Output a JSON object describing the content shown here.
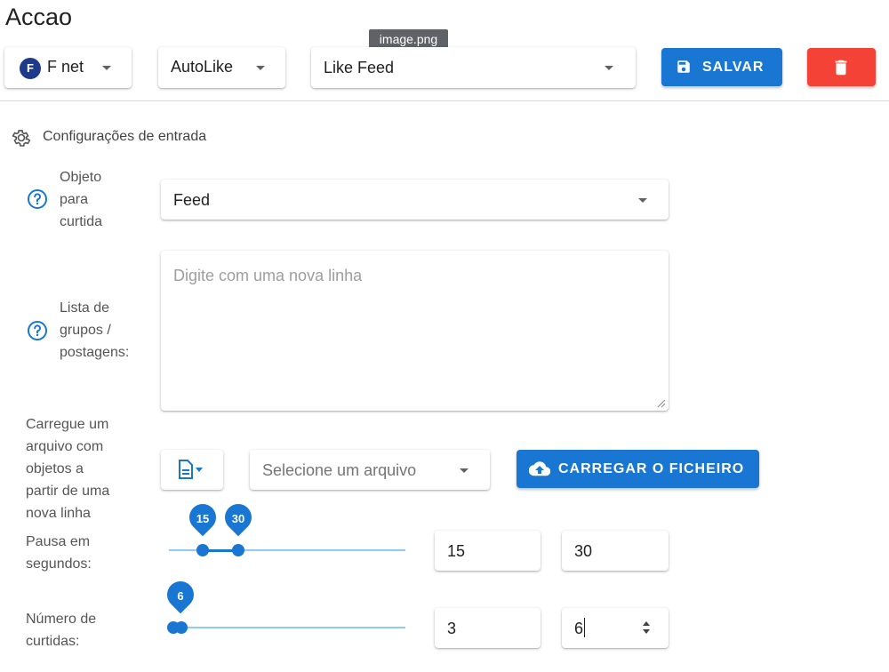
{
  "page": {
    "title": "Accao",
    "tooltip": "image.png"
  },
  "toolbar": {
    "account": {
      "initial": "F",
      "name": "F net"
    },
    "type": "AutoLike",
    "action": "Like Feed",
    "save_label": "SALVAR",
    "colors": {
      "primary": "#1976d2",
      "danger": "#f44336"
    }
  },
  "section": {
    "title": "Configurações de entrada"
  },
  "form": {
    "object": {
      "label_lines": [
        "Objeto",
        "para",
        "curtida"
      ],
      "value": "Feed"
    },
    "groups": {
      "label_lines": [
        "Lista de",
        "grupos /",
        "postagens:"
      ],
      "placeholder": "Digite com uma nova linha"
    },
    "upload": {
      "label_lines": [
        "Carregue um",
        "arquivo com",
        "objetos a",
        "partir de uma",
        "nova linha"
      ],
      "file_select": "Selecione um arquivo",
      "button_label": "CARREGAR O FICHEIRO"
    },
    "pause": {
      "label_lines": [
        "Pausa em",
        "segundos:"
      ],
      "min_label": "15",
      "max_label": "30",
      "min_value": "15",
      "max_value": "30"
    },
    "likes": {
      "label_lines": [
        "Número de",
        "curtidas:"
      ],
      "pin_label": "6",
      "min_value": "3",
      "max_value": "6"
    }
  }
}
